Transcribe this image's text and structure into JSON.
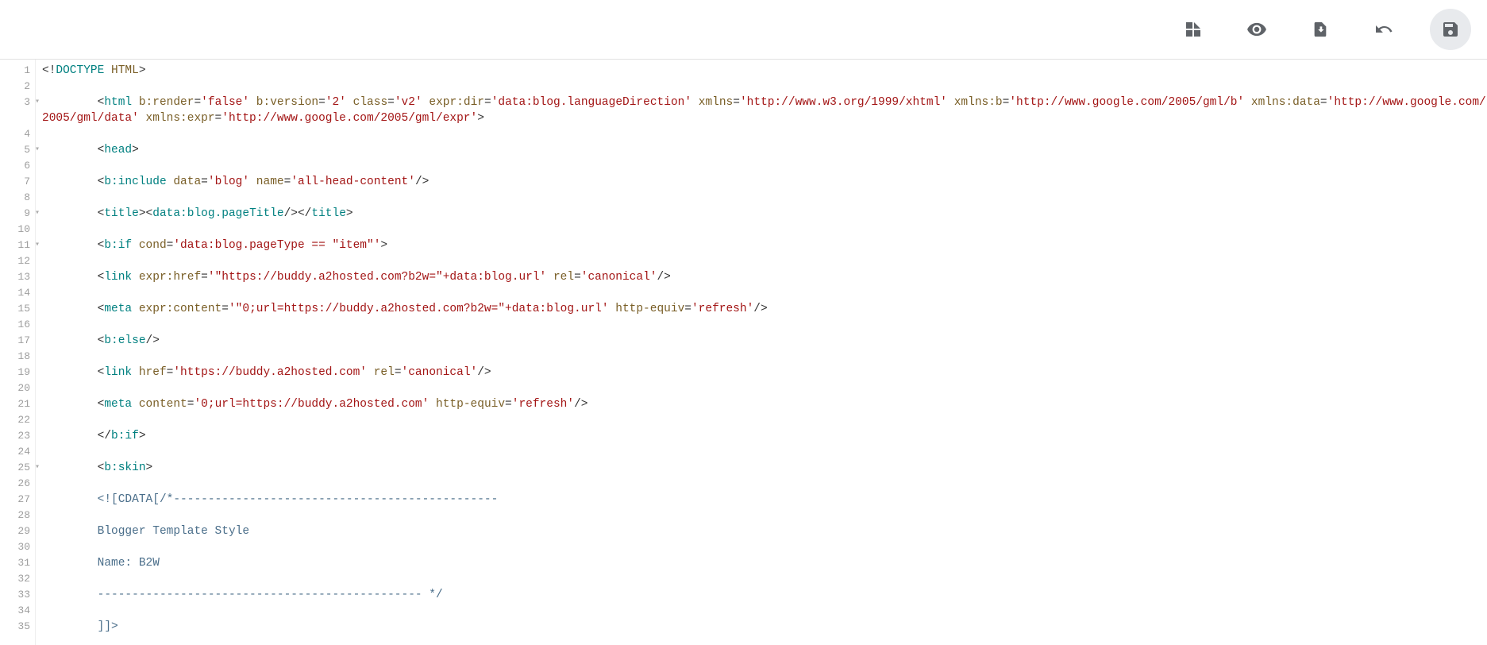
{
  "toolbar": {
    "icons": [
      "dashboard",
      "preview",
      "restore",
      "undo",
      "save"
    ]
  },
  "editor": {
    "lines": [
      {
        "n": 1,
        "fold": false,
        "html": "<span class='punct'>&lt;!</span><span class='tag'>DOCTYPE</span> <span class='attr'>HTML</span><span class='punct'>&gt;</span>"
      },
      {
        "n": 2,
        "fold": false,
        "html": ""
      },
      {
        "n": 3,
        "fold": true,
        "tall": true,
        "html": "        <span class='punct'>&lt;</span><span class='tag'>html</span> <span class='attr'>b:render</span>=<span class='str'>'false'</span> <span class='attr'>b:version</span>=<span class='str'>'2'</span> <span class='attr'>class</span>=<span class='str'>'v2'</span> <span class='attr'>expr:dir</span>=<span class='str'>'data:blog.languageDirection'</span> <span class='attr'>xmlns</span>=<span class='str'>'http://www.w3.org/1999/xhtml'</span> <span class='attr'>xmlns:b</span>=<span class='str'>'http://www.google.com/2005/gml/b'</span> <span class='attr'>xmlns:data</span>=<span class='str'>'http://www.google.com/2005/gml/data'</span> <span class='attr'>xmlns:expr</span>=<span class='str'>'http://www.google.com/2005/gml/expr'</span><span class='punct'>&gt;</span>"
      },
      {
        "n": 4,
        "fold": false,
        "html": ""
      },
      {
        "n": 5,
        "fold": true,
        "html": "        <span class='punct'>&lt;</span><span class='tag'>head</span><span class='punct'>&gt;</span>"
      },
      {
        "n": 6,
        "fold": false,
        "html": ""
      },
      {
        "n": 7,
        "fold": false,
        "html": "        <span class='punct'>&lt;</span><span class='tag'>b:include</span> <span class='attr'>data</span>=<span class='str'>'blog'</span> <span class='attr'>name</span>=<span class='str'>'all-head-content'</span><span class='punct'>/&gt;</span>"
      },
      {
        "n": 8,
        "fold": false,
        "html": ""
      },
      {
        "n": 9,
        "fold": true,
        "html": "        <span class='punct'>&lt;</span><span class='tag'>title</span><span class='punct'>&gt;&lt;</span><span class='tag'>data:blog.pageTitle</span><span class='punct'>/&gt;&lt;/</span><span class='tag'>title</span><span class='punct'>&gt;</span>"
      },
      {
        "n": 10,
        "fold": false,
        "html": ""
      },
      {
        "n": 11,
        "fold": true,
        "html": "        <span class='punct'>&lt;</span><span class='tag'>b:if</span> <span class='attr'>cond</span>=<span class='str'>'data:blog.pageType == &quot;item&quot;'</span><span class='punct'>&gt;</span>"
      },
      {
        "n": 12,
        "fold": false,
        "html": ""
      },
      {
        "n": 13,
        "fold": false,
        "html": "        <span class='punct'>&lt;</span><span class='tag'>link</span> <span class='attr'>expr:href</span>=<span class='str'>'&quot;https://buddy.a2hosted.com?b2w=&quot;+data:blog.url'</span> <span class='attr'>rel</span>=<span class='str'>'canonical'</span><span class='punct'>/&gt;</span>"
      },
      {
        "n": 14,
        "fold": false,
        "html": ""
      },
      {
        "n": 15,
        "fold": false,
        "html": "        <span class='punct'>&lt;</span><span class='tag'>meta</span> <span class='attr'>expr:content</span>=<span class='str'>'&quot;0;url=https://buddy.a2hosted.com?b2w=&quot;+data:blog.url'</span> <span class='attr'>http-equiv</span>=<span class='str'>'refresh'</span><span class='punct'>/&gt;</span>"
      },
      {
        "n": 16,
        "fold": false,
        "html": ""
      },
      {
        "n": 17,
        "fold": false,
        "html": "        <span class='punct'>&lt;</span><span class='tag'>b:else</span><span class='punct'>/&gt;</span>"
      },
      {
        "n": 18,
        "fold": false,
        "html": ""
      },
      {
        "n": 19,
        "fold": false,
        "html": "        <span class='punct'>&lt;</span><span class='tag'>link</span> <span class='attr'>href</span>=<span class='str'>'https://buddy.a2hosted.com'</span> <span class='attr'>rel</span>=<span class='str'>'canonical'</span><span class='punct'>/&gt;</span>"
      },
      {
        "n": 20,
        "fold": false,
        "html": ""
      },
      {
        "n": 21,
        "fold": false,
        "html": "        <span class='punct'>&lt;</span><span class='tag'>meta</span> <span class='attr'>content</span>=<span class='str'>'0;url=https://buddy.a2hosted.com'</span> <span class='attr'>http-equiv</span>=<span class='str'>'refresh'</span><span class='punct'>/&gt;</span>"
      },
      {
        "n": 22,
        "fold": false,
        "html": ""
      },
      {
        "n": 23,
        "fold": false,
        "html": "        <span class='punct'>&lt;/</span><span class='tag'>b:if</span><span class='punct'>&gt;</span>"
      },
      {
        "n": 24,
        "fold": false,
        "html": ""
      },
      {
        "n": 25,
        "fold": true,
        "html": "        <span class='punct'>&lt;</span><span class='tag'>b:skin</span><span class='punct'>&gt;</span>"
      },
      {
        "n": 26,
        "fold": false,
        "html": ""
      },
      {
        "n": 27,
        "fold": false,
        "html": "        <span class='txt'>&lt;![CDATA[/*-----------------------------------------------</span>"
      },
      {
        "n": 28,
        "fold": false,
        "html": ""
      },
      {
        "n": 29,
        "fold": false,
        "html": "        <span class='txt'>Blogger Template Style</span>"
      },
      {
        "n": 30,
        "fold": false,
        "html": ""
      },
      {
        "n": 31,
        "fold": false,
        "html": "        <span class='txt'>Name: B2W</span>"
      },
      {
        "n": 32,
        "fold": false,
        "html": ""
      },
      {
        "n": 33,
        "fold": false,
        "html": "        <span class='txt'>----------------------------------------------- */</span>"
      },
      {
        "n": 34,
        "fold": false,
        "html": ""
      },
      {
        "n": 35,
        "fold": false,
        "html": "        <span class='txt'>]]&gt;</span>"
      }
    ]
  }
}
